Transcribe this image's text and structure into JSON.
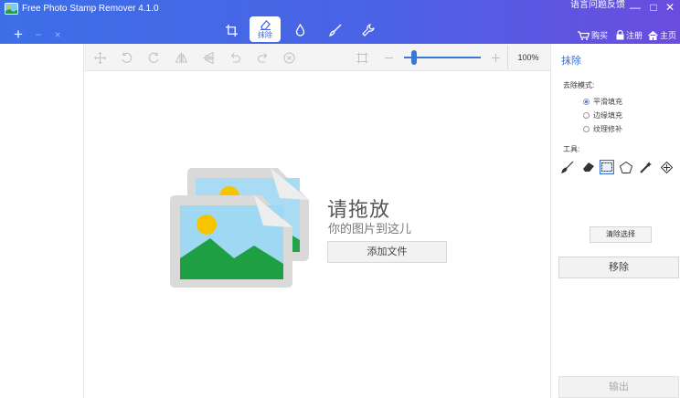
{
  "app": {
    "title": "Free Photo Stamp Remover 4.1.0"
  },
  "header": {
    "language_label": "语言",
    "feedback_label": "问题反馈",
    "minimize_symbol": "—",
    "maximize_symbol": "□",
    "close_symbol": "✕",
    "add_symbol": "+",
    "remove_symbol": "−",
    "clear_symbol": "×",
    "mode_tabs": [
      {
        "name": "crop",
        "icon": "crop-icon",
        "active": false
      },
      {
        "name": "erase",
        "icon": "eraser-icon",
        "active": true,
        "label": "抹除"
      },
      {
        "name": "watermark",
        "icon": "drop-icon",
        "active": false
      },
      {
        "name": "brush",
        "icon": "brush-icon",
        "active": false
      },
      {
        "name": "tools",
        "icon": "wrench-icon",
        "active": false
      }
    ],
    "buy_label": "购买",
    "register_label": "注册",
    "home_label": "主页"
  },
  "canvas_toolbar": {
    "icons": [
      "move-icon",
      "rotate-left-icon",
      "rotate-right-icon",
      "flip-horizontal-icon",
      "flip-vertical-icon",
      "undo-icon",
      "redo-icon",
      "cancel-icon",
      "fit-screen-icon",
      "zoom-out-icon",
      "zoom-in-icon"
    ],
    "zoom_value": "100%",
    "zoom_level": 0.1
  },
  "drop_zone": {
    "title": "请拖放",
    "subtitle": "你的图片到这儿",
    "add_file_label": "添加文件"
  },
  "right_panel": {
    "title": "抹除",
    "mode_label": "去除模式:",
    "modes": [
      {
        "label": "平滑填充",
        "checked": true
      },
      {
        "label": "边缘填充",
        "checked": false
      },
      {
        "label": "纹理修补",
        "checked": false
      }
    ],
    "tools_label": "工具:",
    "tools": [
      "brush-tool-icon",
      "eraser-tool-icon",
      "rectangle-select-icon",
      "polygon-select-icon",
      "magic-wand-icon",
      "move-tool-icon"
    ],
    "active_tool": "rectangle-select-icon",
    "clear_selection_label": "清除选择",
    "remove_label": "移除",
    "output_label": "输出"
  },
  "colors": {
    "header_start": "#3d6ee8",
    "header_end": "#6a4ce0",
    "accent": "#3a6fd8"
  }
}
